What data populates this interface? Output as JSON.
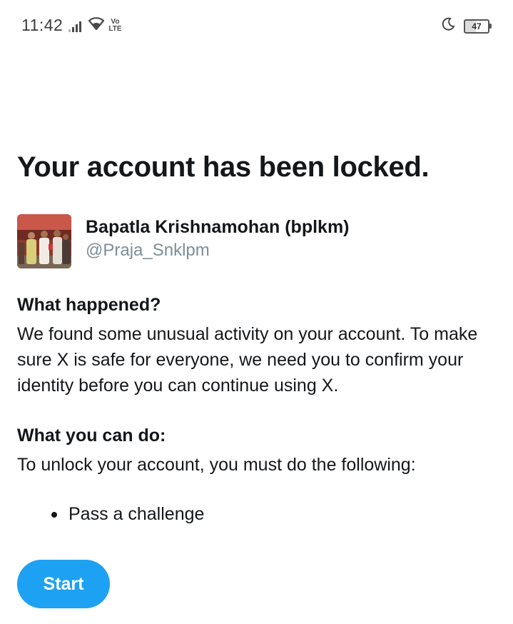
{
  "status_bar": {
    "time": "11:42",
    "network_badge_top": "Vo",
    "network_badge_bottom": "LTE",
    "battery_level": "47",
    "icons": [
      "signal-icon",
      "wifi-icon",
      "volte-icon",
      "moon-icon",
      "battery-icon"
    ]
  },
  "page": {
    "title": "Your account has been locked."
  },
  "profile": {
    "display_name": "Bapatla Krishnamohan (bplkm)",
    "handle": "@Praja_Snklpm"
  },
  "what_happened": {
    "heading": "What happened?",
    "body": "We found some unusual activity on your account. To make sure X is safe for everyone, we need you to confirm your identity before you can continue using X."
  },
  "what_you_can_do": {
    "heading": "What you can do:",
    "body": "To unlock your account, you must do the following:",
    "steps": [
      "Pass a challenge"
    ]
  },
  "actions": {
    "start_label": "Start"
  },
  "colors": {
    "accent": "#1da1f2",
    "text_primary": "#14171a",
    "text_secondary": "#7d8e99"
  }
}
